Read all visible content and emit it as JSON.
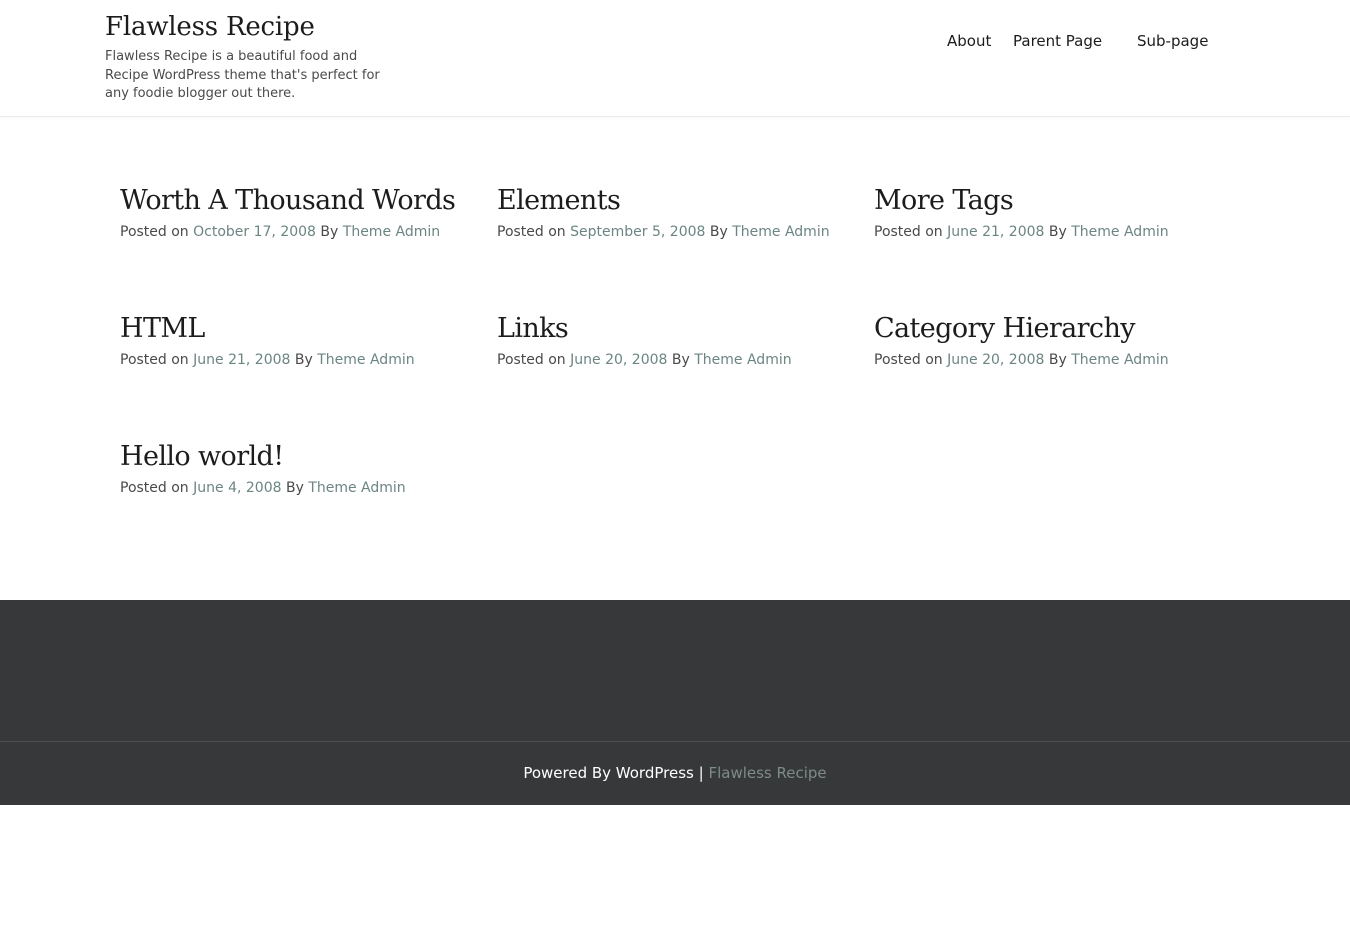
{
  "header": {
    "site_title": "Flawless Recipe",
    "site_description": "Flawless Recipe is a beautiful food and Recipe WordPress theme that's perfect for any foodie blogger out there.",
    "nav": [
      "About",
      "Parent Page",
      "Sub-page"
    ]
  },
  "meta_labels": {
    "posted_on": "Posted on",
    "by": "By"
  },
  "posts": [
    {
      "title": "Worth A Thousand Words",
      "date": "October 17, 2008",
      "author": "Theme Admin"
    },
    {
      "title": "Elements",
      "date": "September 5, 2008",
      "author": "Theme Admin"
    },
    {
      "title": "More Tags",
      "date": "June 21, 2008",
      "author": "Theme Admin"
    },
    {
      "title": "HTML",
      "date": "June 21, 2008",
      "author": "Theme Admin"
    },
    {
      "title": "Links",
      "date": "June 20, 2008",
      "author": "Theme Admin"
    },
    {
      "title": "Category Hierarchy",
      "date": "June 20, 2008",
      "author": "Theme Admin"
    },
    {
      "title": "Hello world!",
      "date": "June 4, 2008",
      "author": "Theme Admin"
    }
  ],
  "footer": {
    "powered_by": "Powered By WordPress |",
    "theme_link": "Flawless Recipe"
  },
  "colors": {
    "link": "#6b8583",
    "footer_bg": "#363839",
    "text": "#1c1c1c"
  }
}
